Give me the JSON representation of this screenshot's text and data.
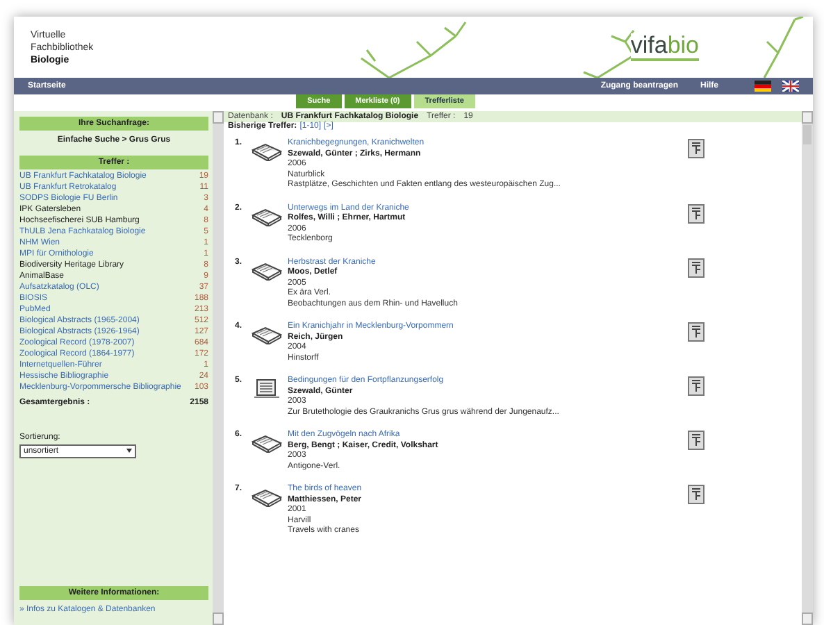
{
  "header": {
    "title_lines": [
      "Virtuelle",
      "Fachbibliothek"
    ],
    "title_bold": "Biologie",
    "logo": {
      "part1": "vif",
      "part2": "a",
      "part3": "bio"
    }
  },
  "navbar": {
    "home": "Startseite",
    "links": [
      "Zugang beantragen",
      "Hilfe"
    ]
  },
  "tabs": [
    {
      "label": "Suche",
      "selected": false
    },
    {
      "label": "Merkliste (0)",
      "selected": false
    },
    {
      "label": "Trefferliste",
      "selected": true
    }
  ],
  "sidebar": {
    "query_heading": "Ihre Suchanfrage:",
    "query": "Einfache Suche > Grus Grus",
    "hits_heading": "Treffer :",
    "sources": [
      {
        "name": "UB Frankfurt Fachkatalog Biologie",
        "count": "19",
        "link": true
      },
      {
        "name": "UB Frankfurt Retrokatalog",
        "count": "11",
        "link": true
      },
      {
        "name": "SODPS Biologie FU Berlin",
        "count": "3",
        "link": true
      },
      {
        "name": "IPK Gatersleben",
        "count": "4",
        "link": false
      },
      {
        "name": "Hochseefischerei SUB Hamburg",
        "count": "8",
        "link": false
      },
      {
        "name": "ThULB Jena Fachkatalog Biologie",
        "count": "5",
        "link": true
      },
      {
        "name": "NHM Wien",
        "count": "1",
        "link": true
      },
      {
        "name": "MPI für Ornithologie",
        "count": "1",
        "link": true
      },
      {
        "name": "Biodiversity Heritage Library",
        "count": "8",
        "link": false
      },
      {
        "name": "AnimalBase",
        "count": "9",
        "link": false
      },
      {
        "name": "Aufsatzkatalog (OLC)",
        "count": "37",
        "link": true
      },
      {
        "name": "BIOSIS",
        "count": "188",
        "link": true
      },
      {
        "name": "PubMed",
        "count": "213",
        "link": true
      },
      {
        "name": "Biological Abstracts (1965-2004)",
        "count": "512",
        "link": true
      },
      {
        "name": "Biological Abstracts (1926-1964)",
        "count": "127",
        "link": true
      },
      {
        "name": "Zoological Record (1978-2007)",
        "count": "684",
        "link": true
      },
      {
        "name": "Zoological Record (1864-1977)",
        "count": "172",
        "link": true
      },
      {
        "name": "Internetquellen-Führer",
        "count": "1",
        "link": true
      },
      {
        "name": "Hessische Bibliographie",
        "count": "24",
        "link": true
      },
      {
        "name": "Mecklenburg-Vorpommersche Bibliographie",
        "count": "103",
        "link": true
      }
    ],
    "total_label": "Gesamtergebnis :",
    "total": "2158",
    "sort_label": "Sortierung:",
    "sort_value": "unsortiert",
    "info_heading": "Weitere Informationen:",
    "info_link": "» Infos zu Katalogen & Datenbanken"
  },
  "results_header": {
    "db_label": "Datenbank :",
    "db_name": "UB Frankfurt Fachkatalog Biologie",
    "hits_label": "Treffer :",
    "hits": "19",
    "prev_label": "Bisherige Treffer:",
    "range": "[1-10]",
    "next": "[>]"
  },
  "results": [
    {
      "number": "1.",
      "kind": "book",
      "title": "Kranichbegegnungen, Kranichwelten",
      "author": "Szewald, Günter ; Zirks, Hermann",
      "lines": [
        "2006",
        "Naturblick",
        "Rastplätze, Geschichten und Fakten entlang des westeuropäischen Zug..."
      ]
    },
    {
      "number": "2.",
      "kind": "book",
      "title": "Unterwegs im Land der Kraniche",
      "author": "Rolfes, Willi ; Ehrner, Hartmut",
      "lines": [
        "2006",
        "Tecklenborg"
      ]
    },
    {
      "number": "3.",
      "kind": "book",
      "title": "Herbstrast der Kraniche",
      "author": "Moos, Detlef",
      "lines": [
        "2005",
        "Ex ära Verl.",
        "Beobachtungen aus dem Rhin- und Havelluch"
      ]
    },
    {
      "number": "4.",
      "kind": "book",
      "title": "Ein Kranichjahr in Mecklenburg-Vorpommern",
      "author": "Reich, Jürgen",
      "lines": [
        "2004",
        "Hinstorff"
      ]
    },
    {
      "number": "5.",
      "kind": "article",
      "title": "Bedingungen für den Fortpflanzungserfolg",
      "author": "Szewald, Günter",
      "lines": [
        "2003",
        "Zur Brutethologie des Graukranichs Grus grus während der Jungenaufz..."
      ]
    },
    {
      "number": "6.",
      "kind": "book",
      "title": "Mit den Zugvögeln nach Afrika",
      "author": "Berg, Bengt ; Kaiser, Credit, Volkshart",
      "lines": [
        "2003",
        "Antigone-Verl."
      ]
    },
    {
      "number": "7.",
      "kind": "book",
      "title": "The birds of heaven",
      "author": "Matthiessen, Peter",
      "lines": [
        "2001",
        "Harvill",
        "Travels with cranes"
      ]
    }
  ]
}
